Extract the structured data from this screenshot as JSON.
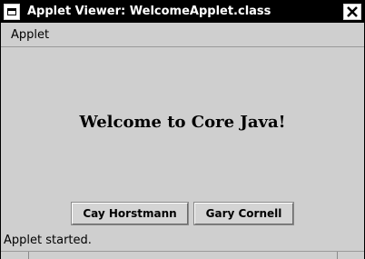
{
  "window": {
    "title": "Applet Viewer: WelcomeApplet.class"
  },
  "menubar": {
    "items": [
      {
        "label": "Applet"
      }
    ]
  },
  "applet": {
    "message": "Welcome to Core Java!",
    "buttons": [
      {
        "label": "Cay Horstmann"
      },
      {
        "label": "Gary Cornell"
      }
    ]
  },
  "status": {
    "text": "Applet started."
  },
  "icons": {
    "window_menu": "window-menu-icon",
    "close": "close-icon"
  },
  "colors": {
    "titlebar": "#000000",
    "titlebar_text": "#ffffff",
    "background": "#cfcfcf"
  }
}
